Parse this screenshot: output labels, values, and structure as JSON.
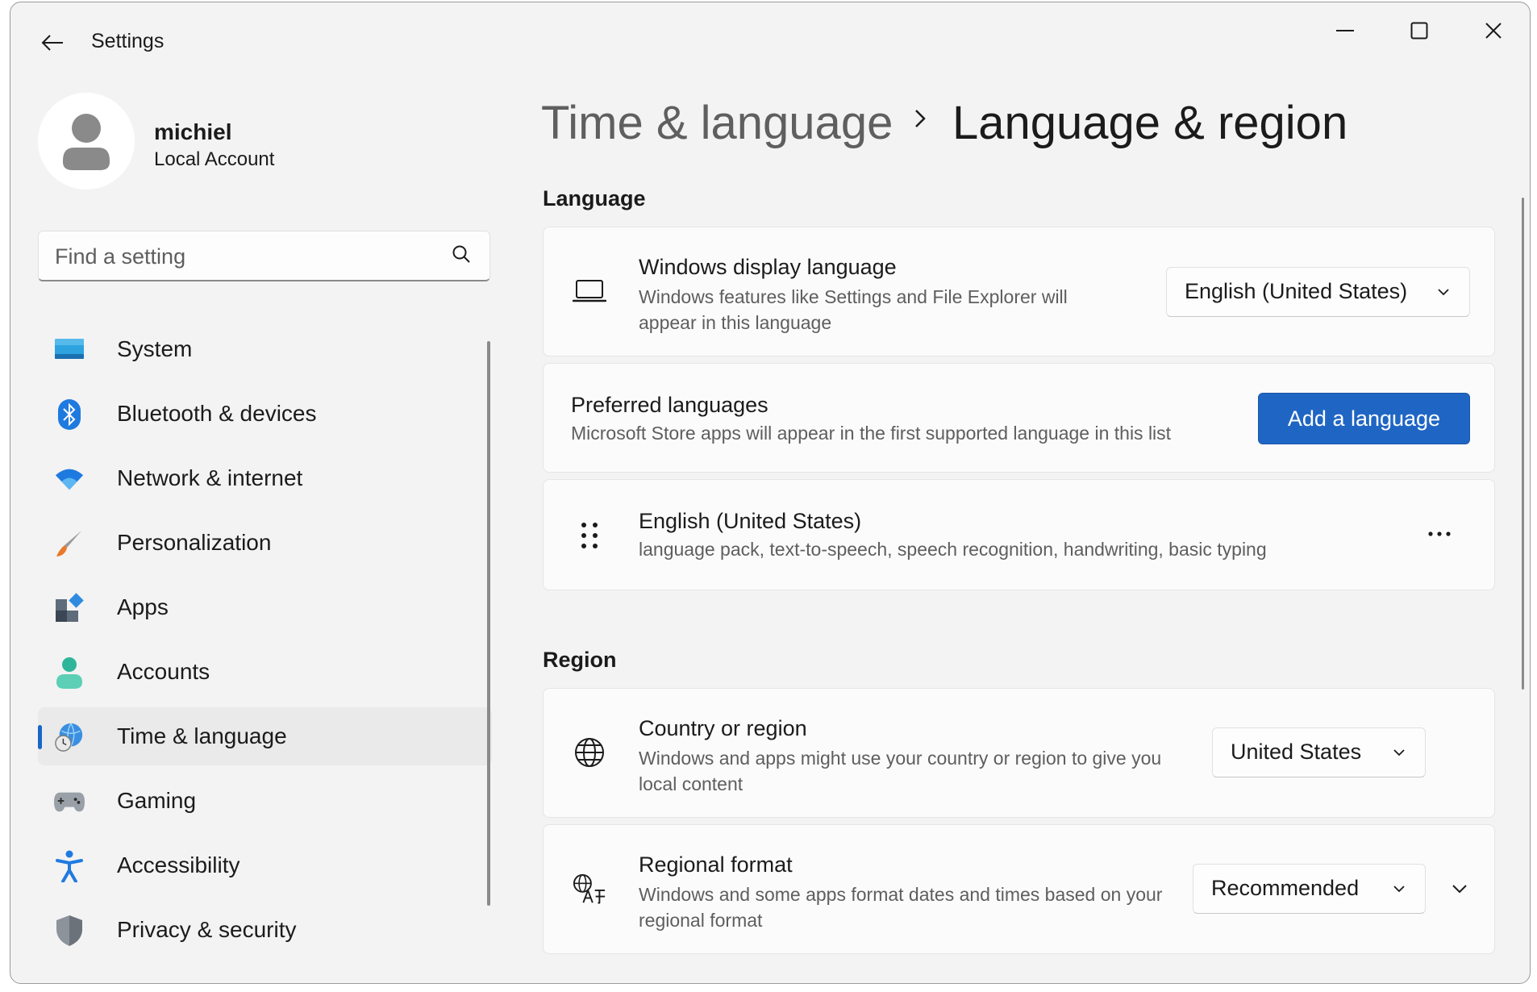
{
  "window": {
    "title": "Settings"
  },
  "profile": {
    "name": "michiel",
    "account_type": "Local Account"
  },
  "search": {
    "placeholder": "Find a setting"
  },
  "sidebar": {
    "items": [
      {
        "label": "System",
        "icon": "system-icon"
      },
      {
        "label": "Bluetooth & devices",
        "icon": "bluetooth-icon"
      },
      {
        "label": "Network & internet",
        "icon": "wifi-icon"
      },
      {
        "label": "Personalization",
        "icon": "brush-icon"
      },
      {
        "label": "Apps",
        "icon": "apps-icon"
      },
      {
        "label": "Accounts",
        "icon": "accounts-icon"
      },
      {
        "label": "Time & language",
        "icon": "time-language-icon",
        "active": true
      },
      {
        "label": "Gaming",
        "icon": "gamepad-icon"
      },
      {
        "label": "Accessibility",
        "icon": "accessibility-icon"
      },
      {
        "label": "Privacy & security",
        "icon": "shield-icon"
      }
    ]
  },
  "breadcrumb": {
    "parent": "Time & language",
    "current": "Language & region"
  },
  "language_section": {
    "title": "Language",
    "display_language": {
      "title": "Windows display language",
      "description": "Windows features like Settings and File Explorer will appear in this language",
      "value": "English (United States)"
    },
    "preferred": {
      "title": "Preferred languages",
      "description": "Microsoft Store apps will appear in the first supported language in this list",
      "button": "Add a language"
    },
    "installed": {
      "title": "English (United States)",
      "description": "language pack, text-to-speech, speech recognition, handwriting, basic typing"
    }
  },
  "region_section": {
    "title": "Region",
    "country": {
      "title": "Country or region",
      "description": "Windows and apps might use your country or region to give you local content",
      "value": "United States"
    },
    "format": {
      "title": "Regional format",
      "description": "Windows and some apps format dates and times based on your regional format",
      "value": "Recommended"
    }
  },
  "colors": {
    "accent": "#1f66c4",
    "selected_bg": "#eaeaea"
  }
}
